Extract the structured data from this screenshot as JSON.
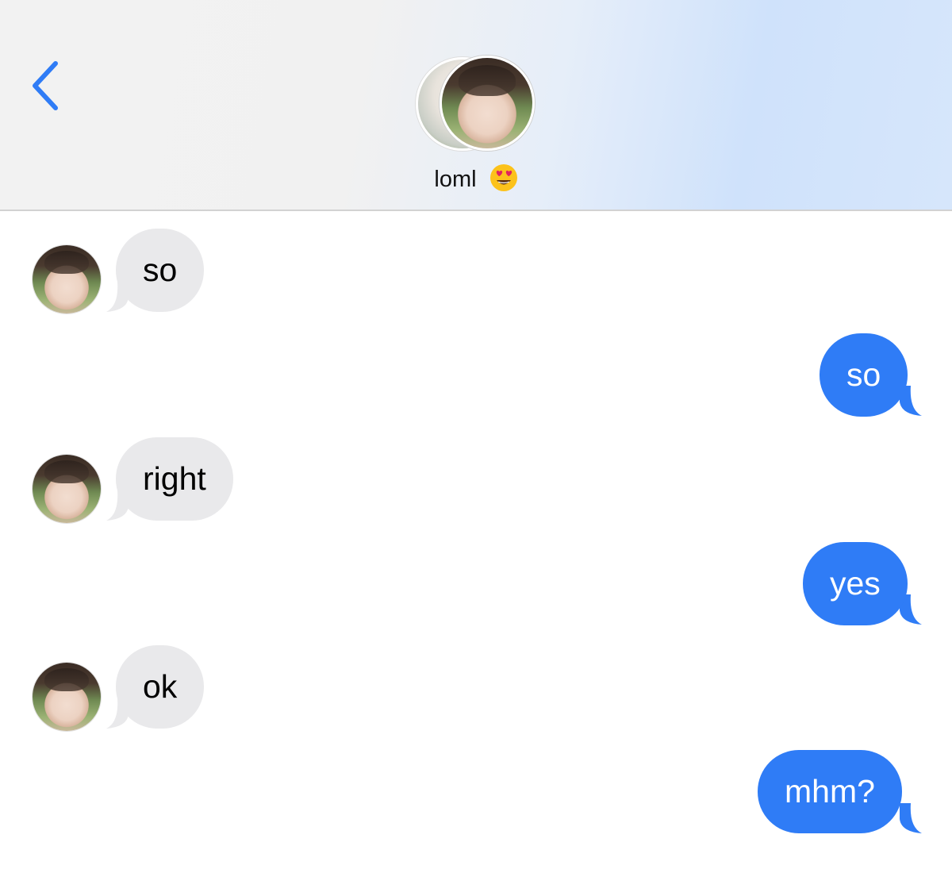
{
  "header": {
    "back_icon": "chevron-left-icon",
    "contact_name": "loml",
    "contact_emoji": "heart-eyes-emoji",
    "accent_color": "#2f7cf6"
  },
  "messages": [
    {
      "direction": "incoming",
      "text": "so"
    },
    {
      "direction": "outgoing",
      "text": "so"
    },
    {
      "direction": "incoming",
      "text": "right"
    },
    {
      "direction": "outgoing",
      "text": "yes"
    },
    {
      "direction": "incoming",
      "text": "ok"
    },
    {
      "direction": "outgoing",
      "text": "mhm?"
    }
  ],
  "colors": {
    "incoming_bubble": "#e9e9eb",
    "outgoing_bubble": "#2f7cf6"
  }
}
